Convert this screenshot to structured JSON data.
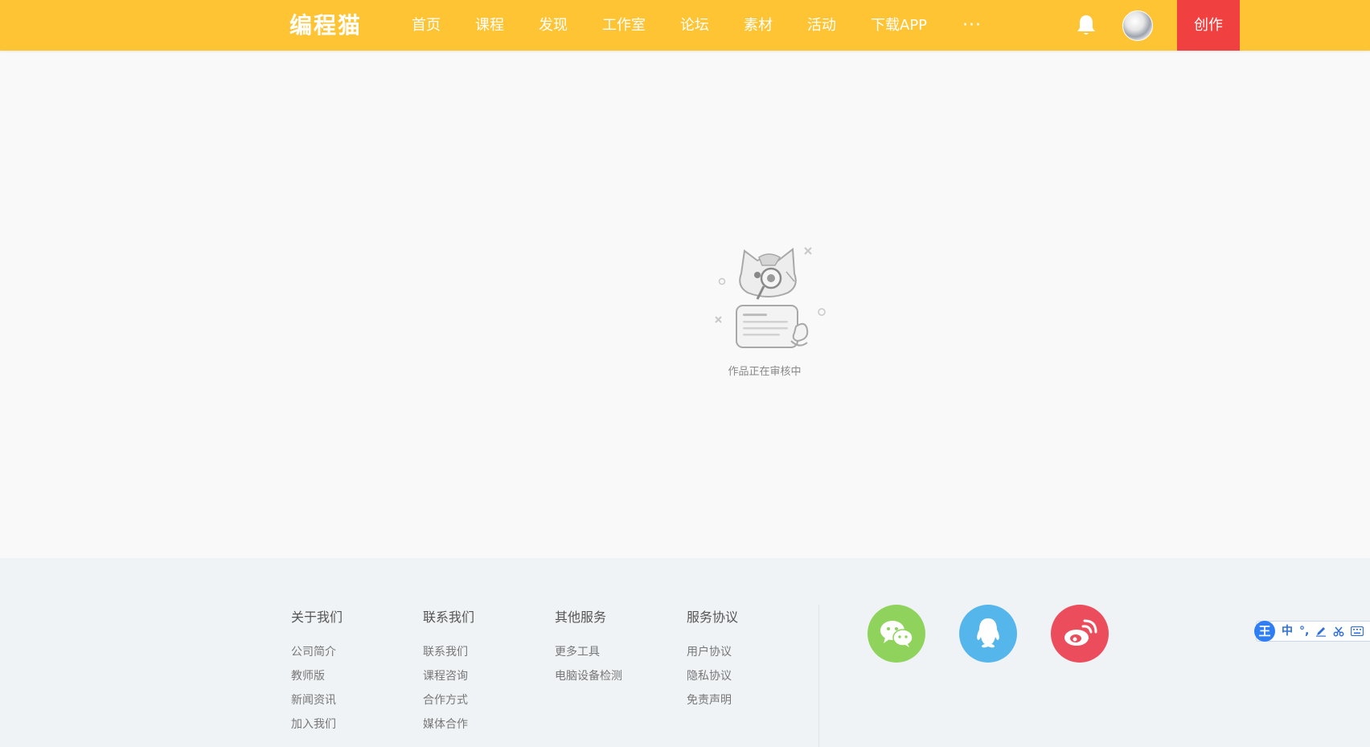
{
  "header": {
    "logo": "编程猫",
    "nav": [
      "首页",
      "课程",
      "发现",
      "工作室",
      "论坛",
      "素材",
      "活动",
      "下载APP"
    ],
    "more": "···",
    "create_label": "创作"
  },
  "empty_state": {
    "message": "作品正在审核中"
  },
  "footer": {
    "columns": [
      {
        "title": "关于我们",
        "links": [
          "公司简介",
          "教师版",
          "新闻资讯",
          "加入我们"
        ]
      },
      {
        "title": "联系我们",
        "links": [
          "联系我们",
          "课程咨询",
          "合作方式",
          "媒体合作"
        ]
      },
      {
        "title": "其他服务",
        "links": [
          "更多工具",
          "电脑设备检测"
        ]
      },
      {
        "title": "服务协议",
        "links": [
          "用户协议",
          "隐私协议",
          "免责声明"
        ]
      }
    ]
  },
  "ime": {
    "logo": "王",
    "mode": "中",
    "punct": "°,"
  },
  "colors": {
    "header_bg": "#ffc434",
    "create_btn": "#f04040",
    "wechat": "#8fd35c",
    "qq": "#55b6ec",
    "weibo": "#ec4d5c"
  }
}
